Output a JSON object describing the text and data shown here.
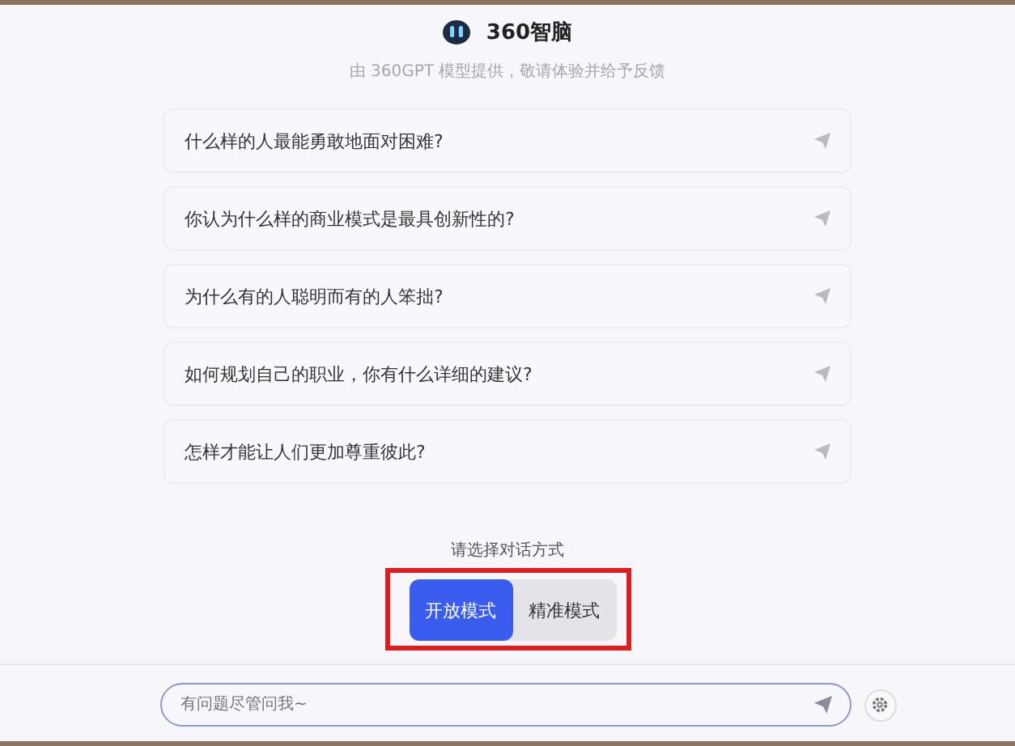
{
  "header": {
    "title": "360智脑",
    "subtitle": "由 360GPT 模型提供，敬请体验并给予反馈"
  },
  "suggestions": [
    {
      "text": "什么样的人最能勇敢地面对困难?"
    },
    {
      "text": "你认为什么样的商业模式是最具创新性的?"
    },
    {
      "text": "为什么有的人聪明而有的人笨拙?"
    },
    {
      "text": "如何规划自己的职业，你有什么详细的建议?"
    },
    {
      "text": "怎样才能让人们更加尊重彼此?"
    }
  ],
  "mode_prompt": "请选择对话方式",
  "modes": [
    {
      "label": "开放模式",
      "selected": true
    },
    {
      "label": "精准模式",
      "selected": false
    }
  ],
  "input": {
    "placeholder": "有问题尽管问我~"
  }
}
